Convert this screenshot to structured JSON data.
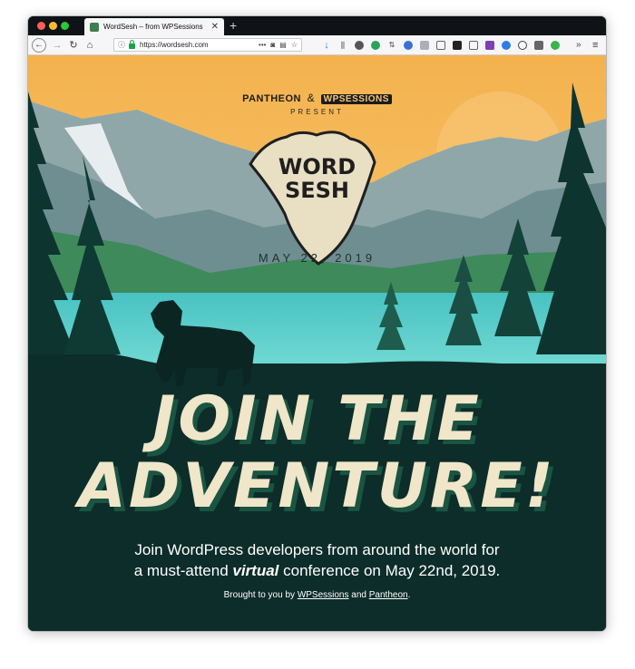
{
  "browser": {
    "tab_title": "WordSesh – from WPSessions",
    "tab_close": "✕",
    "new_tab": "+",
    "url": "https://wordsesh.com",
    "url_overflow": "•••",
    "menu_icon": "≡",
    "overflow_icon": "»"
  },
  "hero": {
    "sponsor_1": "PANTHEON",
    "sponsor_amp": "&",
    "sponsor_2": "WPSESSIONS",
    "present": "PRESENT",
    "logo_line_1": "WORD",
    "logo_line_2": "SESH",
    "date": "MAY 22, 2019"
  },
  "main": {
    "headline_1": "JOIN THE",
    "headline_2": "ADVENTURE!",
    "lead_before": "Join WordPress developers from around the world for",
    "lead_pre": "a must-attend ",
    "lead_em": "virtual",
    "lead_after": " conference on May 22nd, 2019.",
    "credit_pre": "Brought to you by ",
    "credit_link_1": "WPSessions",
    "credit_mid": " and ",
    "credit_link_2": "Pantheon",
    "credit_end": "."
  },
  "colors": {
    "sky": "#f4b24e",
    "lake": "#5ad0cd",
    "forest_dark": "#0c2d29",
    "headline": "#f0e6c9",
    "headline_shadow": "#1a5442"
  }
}
